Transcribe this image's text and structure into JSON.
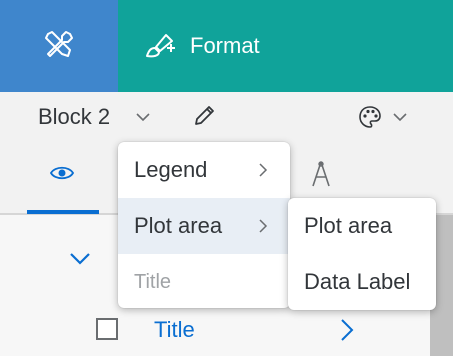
{
  "toolbar": {
    "tools_icon": "wrench-screwdriver-icon",
    "format_icon": "paint-brush-icon",
    "format_label": "Format"
  },
  "header": {
    "block_name": "Block 2",
    "icons": [
      "chevron-down-icon",
      "pencil-icon",
      "palette-icon",
      "chevron-down-icon"
    ]
  },
  "tabs": [
    {
      "icon": "eye-icon",
      "active": true
    },
    {
      "icon": "style-icon",
      "active": false
    }
  ],
  "row": {
    "title": "Title",
    "checked": false
  },
  "context_menu": {
    "items": [
      {
        "label": "Legend",
        "has_submenu": true,
        "disabled": false
      },
      {
        "label": "Plot area",
        "has_submenu": true,
        "disabled": false,
        "highlighted": true
      },
      {
        "label": "Title",
        "has_submenu": false,
        "disabled": true
      }
    ],
    "submenu": {
      "items": [
        {
          "label": "Plot area"
        },
        {
          "label": "Data Label"
        }
      ]
    }
  },
  "colors": {
    "toolbar": "#10a39a",
    "active_tab": "#3f86cc",
    "accent": "#0a6ed1"
  }
}
